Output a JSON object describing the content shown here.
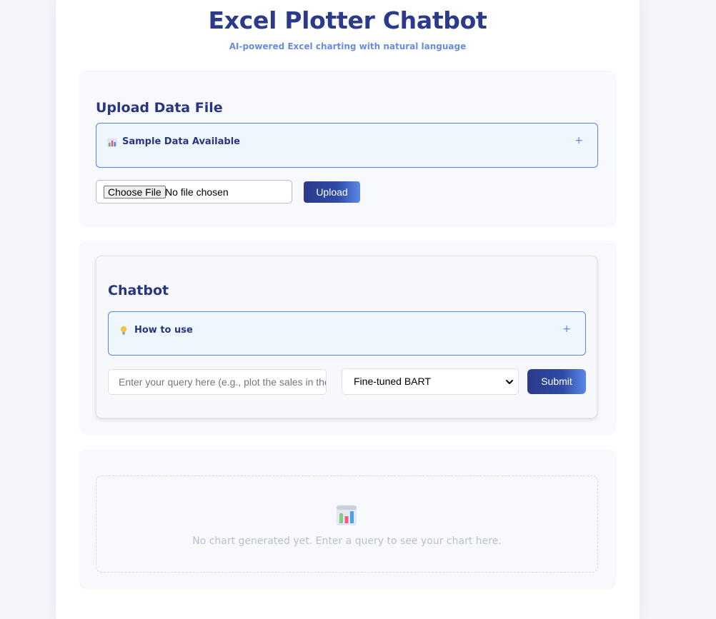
{
  "header": {
    "title": "Excel Plotter Chatbot",
    "subtitle": "AI-powered Excel charting with natural language"
  },
  "upload": {
    "heading": "Upload Data File",
    "accordion": {
      "icon": "bar-chart-icon",
      "label": "Sample Data Available",
      "toggle": "+"
    },
    "file_button": "Choose File",
    "file_status": "No file chosen",
    "upload_button": "Upload"
  },
  "chatbot": {
    "heading": "Chatbot",
    "accordion": {
      "icon": "lightbulb-icon",
      "label": "How to use",
      "toggle": "+"
    },
    "query_placeholder": "Enter your query here (e.g., plot the sales in the",
    "model_selected": "Fine-tuned BART",
    "submit_button": "Submit"
  },
  "chart": {
    "icon": "bar-chart-icon",
    "empty_message": "No chart generated yet. Enter a query to see your chart here."
  },
  "colors": {
    "primary": "#2b3a8a",
    "accent": "#5b83e0",
    "background": "#f3f5fa"
  }
}
